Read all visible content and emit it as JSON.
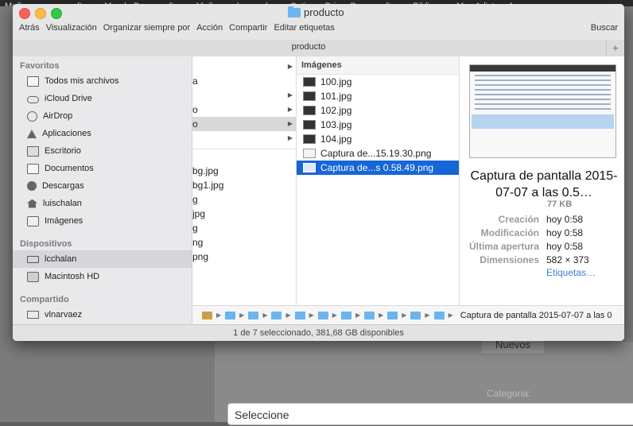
{
  "background": {
    "tabs": [
      "Muñecos papercraft",
      "Mundo Papercraft",
      "Muñecos de papel",
      "Optimus Prime Papercraft",
      "Biblia",
      "Mac Adictos: Aux"
    ],
    "nuevos_label": "Nuevos",
    "categoria_label": "Categoria:",
    "select_value": "Seleccione"
  },
  "window": {
    "title": "producto",
    "toolbar": [
      "Atrás",
      "Visualización",
      "Organizar siempre por",
      "Acción",
      "Compartir",
      "Editar etiquetas"
    ],
    "search_label": "Buscar",
    "path_title": "producto",
    "plus_label": "+"
  },
  "sidebar": {
    "sections": [
      {
        "title": "Favoritos",
        "items": [
          {
            "label": "Todos mis archivos",
            "icon": "all-files-icon"
          },
          {
            "label": "iCloud Drive",
            "icon": "cloud-icon"
          },
          {
            "label": "AirDrop",
            "icon": "airdrop-icon"
          },
          {
            "label": "Aplicaciones",
            "icon": "applications-icon"
          },
          {
            "label": "Escritorio",
            "icon": "desktop-icon"
          },
          {
            "label": "Documentos",
            "icon": "documents-icon"
          },
          {
            "label": "Descargas",
            "icon": "downloads-icon"
          },
          {
            "label": "luischalan",
            "icon": "home-icon"
          },
          {
            "label": "Imágenes",
            "icon": "camera-icon"
          }
        ]
      },
      {
        "title": "Dispositivos",
        "items": [
          {
            "label": "lcchalan",
            "icon": "laptop-icon",
            "selected": true
          },
          {
            "label": "Macintosh HD",
            "icon": "disk-icon"
          }
        ]
      },
      {
        "title": "Compartido",
        "items": [
          {
            "label": "vlnarvaez",
            "icon": "monitor-icon"
          }
        ]
      }
    ]
  },
  "column1": {
    "rows_top": [
      {
        "text": "",
        "arrow": true
      },
      {
        "text": "a",
        "arrow": false
      },
      {
        "text": "",
        "arrow": true
      },
      {
        "text": "o",
        "arrow": true
      },
      {
        "text": "o",
        "arrow": true,
        "selected": true
      },
      {
        "text": "",
        "arrow": true
      }
    ],
    "rows_bottom": [
      "",
      "bg.jpg",
      "bg1.jpg",
      "g",
      "jpg",
      "g",
      "ng",
      "png"
    ]
  },
  "column2": {
    "header": "Imágenes",
    "files": [
      {
        "name": "100.jpg",
        "type": "jpg"
      },
      {
        "name": "101.jpg",
        "type": "jpg"
      },
      {
        "name": "102.jpg",
        "type": "jpg"
      },
      {
        "name": "103.jpg",
        "type": "jpg"
      },
      {
        "name": "104.jpg",
        "type": "jpg"
      },
      {
        "name": "Captura de...15.19.30.png",
        "type": "png"
      },
      {
        "name": "Captura de...s 0.58.49.png",
        "type": "png",
        "selected": true
      }
    ]
  },
  "preview": {
    "title": "Captura de pantalla 2015-07-07 a las 0.5…",
    "size": "77 KB",
    "meta": [
      {
        "key": "Creación",
        "value": "hoy 0:58"
      },
      {
        "key": "Modificación",
        "value": "hoy 0:58"
      },
      {
        "key": "Última apertura",
        "value": "hoy 0:58"
      },
      {
        "key": "Dimensiones",
        "value": "582 × 373"
      }
    ],
    "tags_link": "Etiquetas…"
  },
  "pathstrip": {
    "file_label": "Captura de pantalla 2015-07-07 a las 0"
  },
  "status": "1 de 7 seleccionado, 381,68 GB disponibles"
}
